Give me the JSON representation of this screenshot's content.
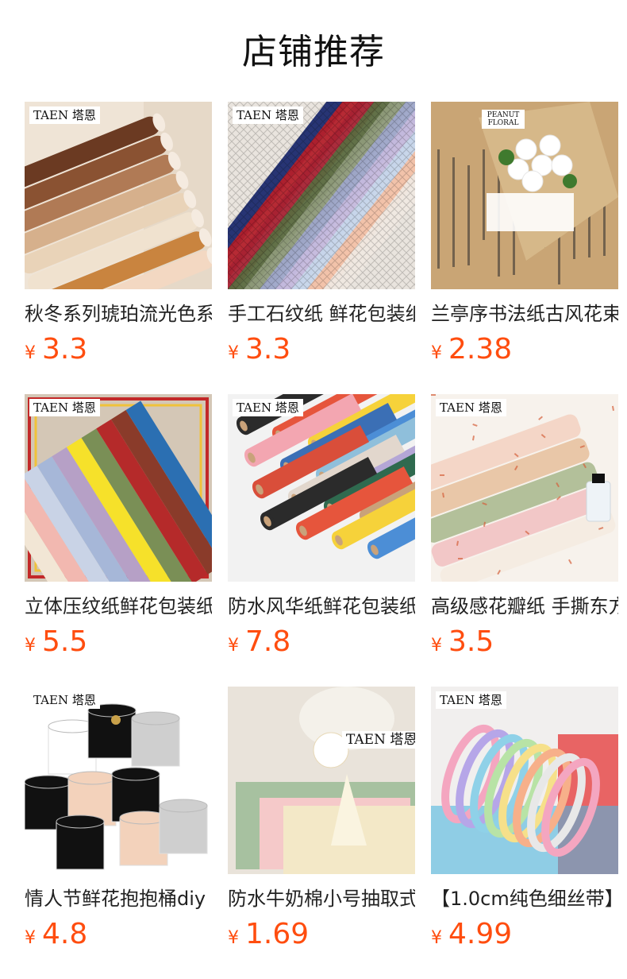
{
  "page": {
    "title": "店铺推荐"
  },
  "currency_symbol": "¥",
  "products": [
    {
      "name": "秋冬系列琥珀流光色系",
      "price": "3.3",
      "brand": "TAEN 塔恩",
      "image": "rolled-amber-paper",
      "colors": [
        "#6b3a22",
        "#8a5232",
        "#b07a55",
        "#d6b08c",
        "#e9d3b8",
        "#f0e2cf",
        "#c9843f",
        "#f3d8c2"
      ]
    },
    {
      "name": "手工石纹纸 鲜花包装纸",
      "price": "3.3",
      "brand": "TAEN 塔恩",
      "image": "stone-texture-paper",
      "colors": [
        "#1c2a6e",
        "#b3202a",
        "#a82233",
        "#5b6a3f",
        "#8e9a7a",
        "#9ea7c9",
        "#c5b9dd",
        "#c7d6ea",
        "#f3c1a6",
        "#efe8e0"
      ]
    },
    {
      "name": "兰亭序书法纸古风花束包装",
      "price": "2.38",
      "brand": "PEANUT FLORAL",
      "image": "calligraphy-bouquet",
      "colors": [
        "#c9a575",
        "#d6b889",
        "#2b2b2b",
        "#ffffff",
        "#3f7a2e"
      ]
    },
    {
      "name": "立体压纹纸鲜花包装纸",
      "price": "5.5",
      "brand": "TAEN 塔恩",
      "image": "embossed-paper",
      "colors": [
        "#f2e6d5",
        "#f2b8b0",
        "#c9d3e6",
        "#a6b7d8",
        "#b6a0c6",
        "#f6e12a",
        "#7a8f56",
        "#b52a2a",
        "#8a3b2a",
        "#2b6fb2"
      ]
    },
    {
      "name": "防水风华纸鲜花包装纸",
      "price": "7.8",
      "brand": "TAEN 塔恩",
      "image": "paper-rolls",
      "colors": [
        "#2b2b2b",
        "#e6553c",
        "#f6d23a",
        "#4c8ed6",
        "#f3a6b1",
        "#3b6fb5",
        "#8fbfdb",
        "#b4a6d6",
        "#d94e3a",
        "#e2d7cd",
        "#2f6a4f",
        "#c9a27a"
      ]
    },
    {
      "name": "高级感花瓣纸 手撕东方",
      "price": "3.5",
      "brand": "TAEN 塔恩",
      "image": "petal-paper",
      "colors": [
        "#f4d6c7",
        "#e9c7a8",
        "#b3c09a",
        "#f2c7c7",
        "#f5ece2",
        "#d4603a"
      ]
    },
    {
      "name": "情人节鲜花抱抱桶diy",
      "price": "4.8",
      "brand": "TAEN 塔恩",
      "image": "flower-buckets",
      "colors": [
        "#111111",
        "#f3d2bb",
        "#cfcfcf",
        "#ffffff",
        "#c9a14a"
      ]
    },
    {
      "name": "防水牛奶棉小号抽取式",
      "price": "1.69",
      "brand": "TAEN 塔恩",
      "image": "milk-cotton-paper",
      "colors": [
        "#a7c1a0",
        "#f3e8c7",
        "#f5c9c9",
        "#ffffff",
        "#e9e3da"
      ]
    },
    {
      "name": "【1.0cm纯色细丝带】",
      "price": "4.99",
      "brand": "TAEN 塔恩",
      "image": "ribbons",
      "colors": [
        "#f4a6c0",
        "#b6a6e8",
        "#8fd1e8",
        "#b8e3a6",
        "#f6e08a",
        "#f7b08a",
        "#e8e8e8",
        "#4fb6e0",
        "#e64b4b"
      ]
    }
  ]
}
